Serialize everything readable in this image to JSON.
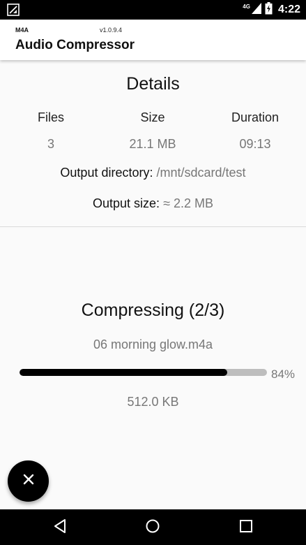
{
  "status_bar": {
    "network": "4G",
    "time": "4:22"
  },
  "app_bar": {
    "format": "M4A",
    "version": "v1.0.9.4",
    "title": "Audio Compressor"
  },
  "details": {
    "title": "Details",
    "columns": [
      {
        "header": "Files",
        "value": "3"
      },
      {
        "header": "Size",
        "value": "21.1 MB"
      },
      {
        "header": "Duration",
        "value": "09:13"
      }
    ],
    "output_directory_label": "Output directory:",
    "output_directory_value": "/mnt/sdcard/test",
    "output_size_label": "Output size:",
    "output_size_value": "≈ 2.2 MB"
  },
  "progress": {
    "title": "Compressing (2/3)",
    "current_file": "06 morning glow.m4a",
    "percent_label": "84%",
    "fraction": 0.84,
    "size": "512.0 KB"
  },
  "fab": {
    "icon": "close-icon"
  },
  "nav_bar": {
    "icons": [
      "back-icon",
      "home-icon",
      "recents-icon"
    ]
  }
}
